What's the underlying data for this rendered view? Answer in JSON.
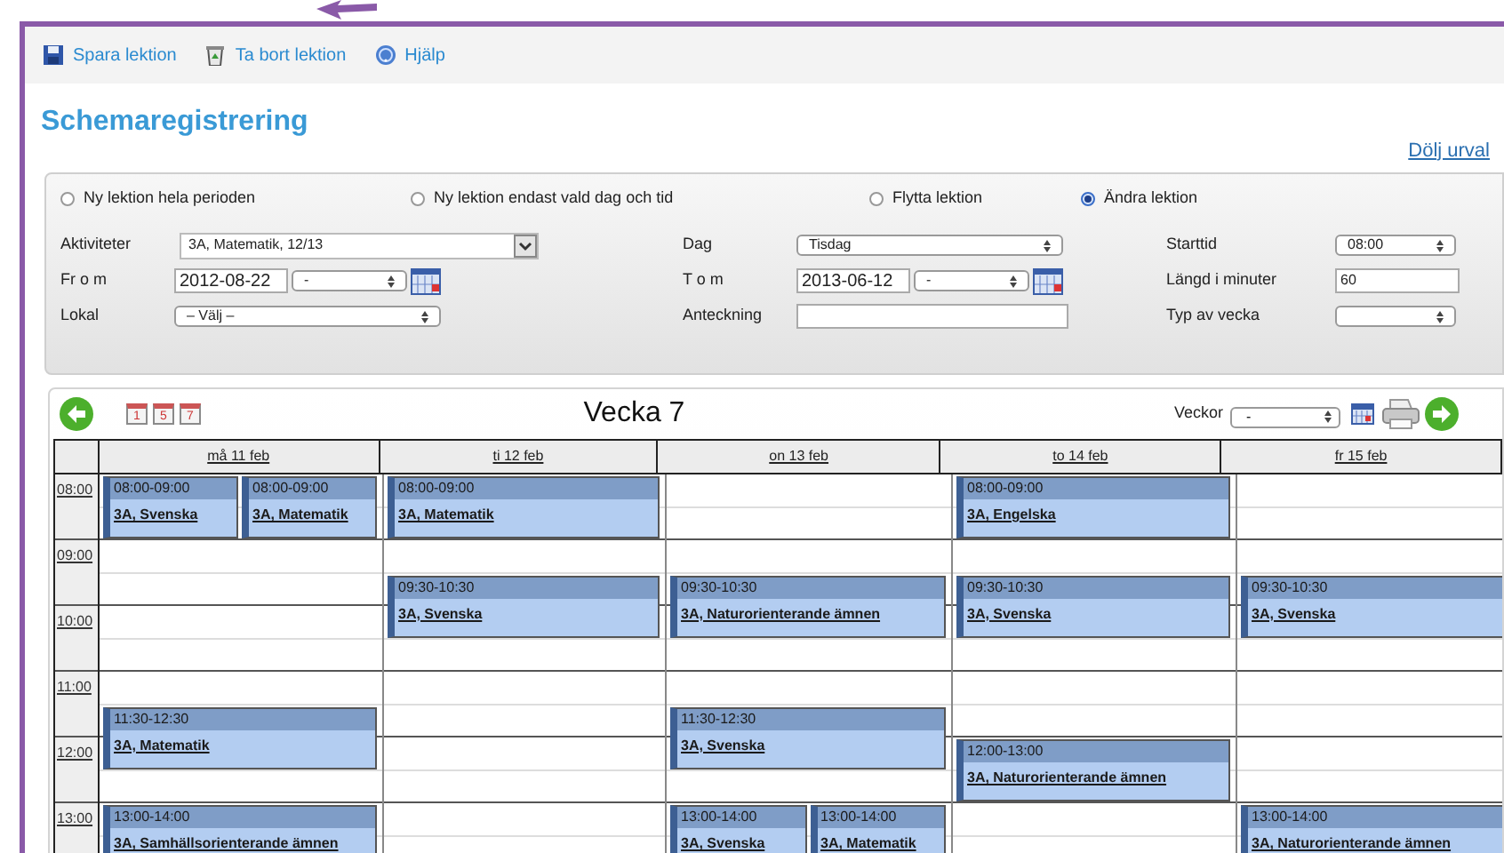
{
  "toolbar": [
    {
      "kind": "save",
      "label": "Spara lektion"
    },
    {
      "kind": "delete",
      "label": "Ta bort lektion"
    },
    {
      "kind": "help",
      "label": "Hjälp"
    }
  ],
  "title": "Schemaregistrering",
  "hide_link": "Dölj urval",
  "modes": [
    {
      "label": "Ny lektion hela perioden",
      "selected": false
    },
    {
      "label": "Ny lektion endast vald dag och tid",
      "selected": false
    },
    {
      "label": "Flytta lektion",
      "selected": false
    },
    {
      "label": "Ändra lektion",
      "selected": true
    }
  ],
  "form_rows": [
    [
      {
        "label": "Aktiviteter",
        "controls": [
          {
            "kind": "combo",
            "value": "3A, Matematik, 12/13"
          }
        ]
      },
      {
        "label": "Dag",
        "controls": [
          {
            "kind": "select",
            "value": "Tisdag"
          }
        ]
      },
      {
        "label": "Starttid",
        "controls": [
          {
            "kind": "select",
            "value": "08:00"
          }
        ]
      }
    ],
    [
      {
        "label": "Fr o m",
        "controls": [
          {
            "kind": "input",
            "value": "2012-08-22"
          },
          {
            "kind": "select",
            "value": "-"
          },
          {
            "kind": "calendar"
          }
        ]
      },
      {
        "label": "T o m",
        "controls": [
          {
            "kind": "input",
            "value": "2013-06-12"
          },
          {
            "kind": "select",
            "value": "-"
          },
          {
            "kind": "calendar"
          }
        ]
      },
      {
        "label": "Längd i minuter",
        "controls": [
          {
            "kind": "input",
            "value": "60"
          }
        ]
      }
    ],
    [
      {
        "label": "Lokal",
        "controls": [
          {
            "kind": "select",
            "value": "– Välj –"
          }
        ]
      },
      {
        "label": "Anteckning",
        "controls": [
          {
            "kind": "input"
          }
        ]
      },
      {
        "label": "Typ av vecka",
        "controls": [
          {
            "kind": "select"
          }
        ]
      }
    ]
  ],
  "calendar": {
    "view_buttons": [
      "1",
      "5",
      "7"
    ],
    "week_title": "Vecka 7",
    "weeks_label": "Veckor",
    "weeks_value": "-",
    "times": [
      "08:00",
      "09:00",
      "10:00",
      "11:00",
      "12:00",
      "13:00"
    ],
    "days": [
      {
        "label": "må 11 feb",
        "events": [
          [
            {
              "time": "08:00-09:00",
              "title": "3A, Svenska"
            },
            {
              "time": "08:00-09:00",
              "title": "3A, Matematik"
            }
          ],
          [
            {
              "time": "11:30-12:30",
              "title": "3A, Matematik"
            }
          ],
          [
            {
              "time": "13:00-14:00",
              "title": "3A, Samhällsorienterande ämnen"
            }
          ]
        ]
      },
      {
        "label": "ti 12 feb",
        "events": [
          [
            {
              "time": "08:00-09:00",
              "title": "3A, Matematik"
            }
          ],
          [
            {
              "time": "09:30-10:30",
              "title": "3A, Svenska"
            }
          ]
        ]
      },
      {
        "label": "on 13 feb",
        "events": [
          [
            {
              "time": "09:30-10:30",
              "title": "3A, Naturorienterande ämnen"
            }
          ],
          [
            {
              "time": "11:30-12:30",
              "title": "3A, Svenska"
            }
          ],
          [
            {
              "time": "13:00-14:00",
              "title": "3A, Svenska"
            },
            {
              "time": "13:00-14:00",
              "title": "3A, Matematik"
            }
          ]
        ]
      },
      {
        "label": "to 14 feb",
        "events": [
          [
            {
              "time": "08:00-09:00",
              "title": "3A, Engelska"
            }
          ],
          [
            {
              "time": "09:30-10:30",
              "title": "3A, Svenska"
            }
          ],
          [
            {
              "time": "12:00-13:00",
              "title": "3A, Naturorienterande ämnen"
            }
          ]
        ]
      },
      {
        "label": "fr 15 feb",
        "events": [
          [
            {
              "time": "09:30-10:30",
              "title": "3A, Svenska"
            }
          ],
          [
            {
              "time": "13:00-14:00",
              "title": "3A, Naturorienterande ämnen"
            }
          ]
        ]
      }
    ]
  }
}
